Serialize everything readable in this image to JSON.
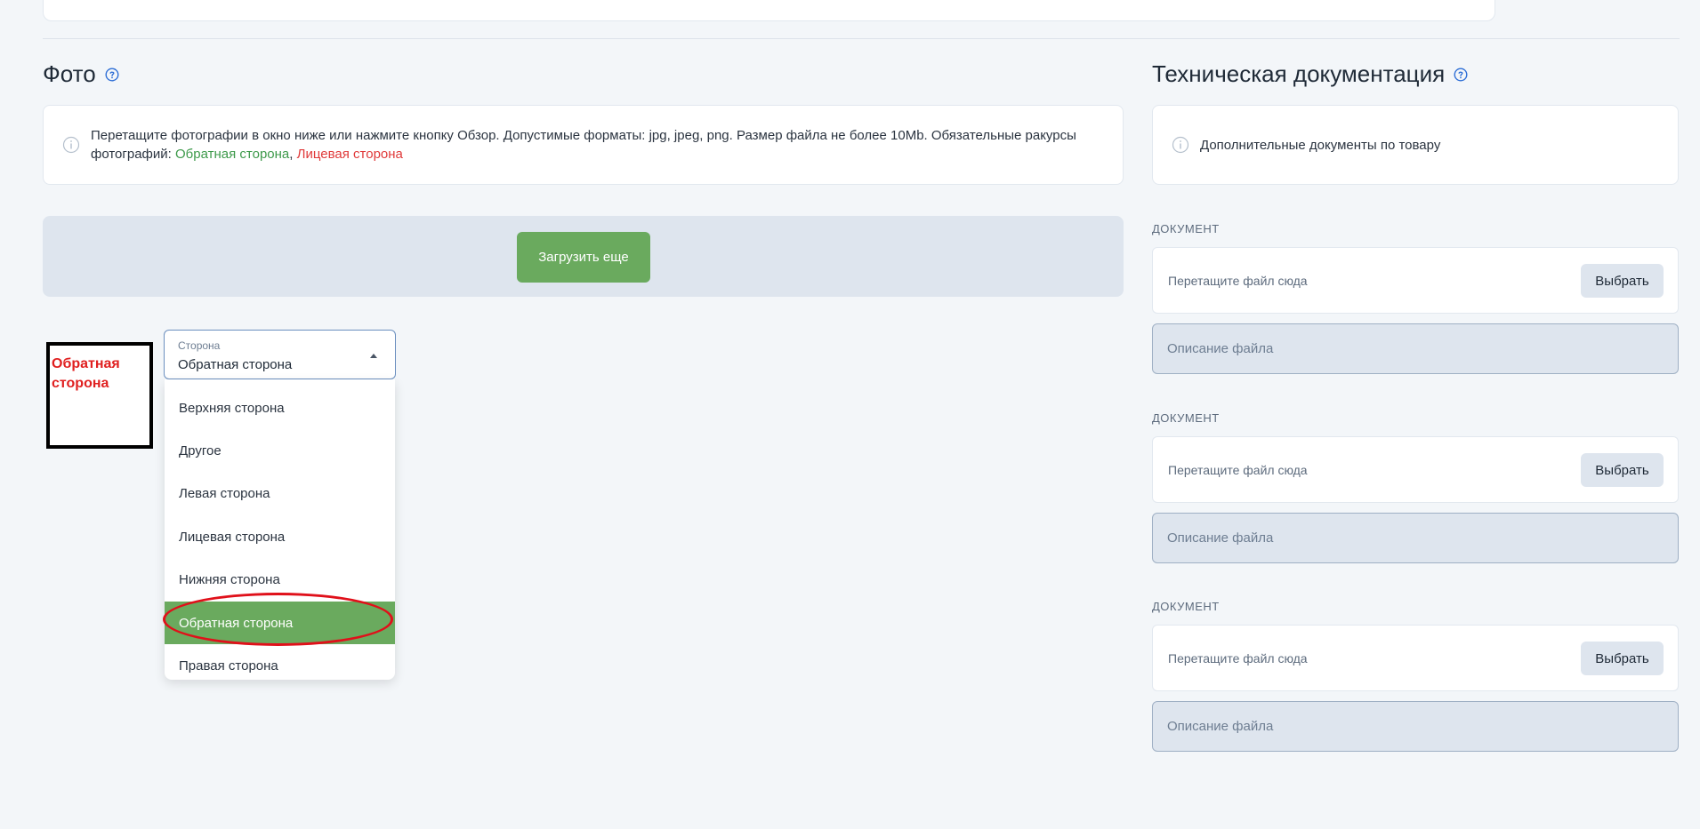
{
  "photo": {
    "title": "Фото",
    "info": {
      "text": "Перетащите фотографии в окно ниже или нажмите кнопку Обзор. Допустимые форматы: jpg, jpeg, png. Размер файла не более 10Mb. Обязательные ракурсы фотографий:",
      "required_green": "Обратная сторона",
      "separator": ",",
      "required_red": "Лицевая сторона"
    },
    "upload_more_label": "Загрузить еще",
    "thumbnail_label": "Обратная сторона",
    "side_select": {
      "caption": "Сторона",
      "value": "Обратная сторона",
      "options": [
        "Верхняя сторона",
        "Другое",
        "Левая сторона",
        "Лицевая сторона",
        "Нижняя сторона",
        "Обратная сторона",
        "Правая сторона"
      ],
      "selected_option": "Обратная сторона"
    }
  },
  "tech_docs": {
    "title": "Техническая документация",
    "info_text": "Дополнительные документы по товару",
    "documents": [
      {
        "label": "ДОКУМЕНТ",
        "drop_text": "Перетащите файл сюда",
        "choose_label": "Выбрать",
        "description_placeholder": "Описание файла"
      },
      {
        "label": "ДОКУМЕНТ",
        "drop_text": "Перетащите файл сюда",
        "choose_label": "Выбрать",
        "description_placeholder": "Описание файла"
      },
      {
        "label": "ДОКУМЕНТ",
        "drop_text": "Перетащите файл сюда",
        "choose_label": "Выбрать",
        "description_placeholder": "Описание файла"
      }
    ]
  },
  "colors": {
    "accent_green": "#6aaa5e",
    "required_green_text": "#3e9a4b",
    "required_red_text": "#e03a3a",
    "annotation_red": "#e0101a",
    "help_icon_blue": "#2f6fd6"
  }
}
